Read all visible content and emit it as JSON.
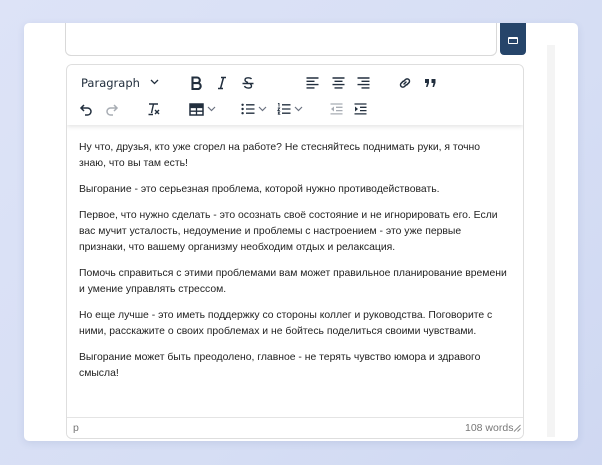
{
  "top_field": {
    "value": ""
  },
  "toolbar": {
    "block_format": "Paragraph",
    "buttons": [
      "bold-icon",
      "italic-icon",
      "strikethrough-icon",
      "align-left-icon",
      "align-center-icon",
      "align-right-icon",
      "link-icon",
      "quote-icon",
      "undo-icon",
      "redo-icon",
      "clear-formatting-icon",
      "table-icon",
      "bullet-list-icon",
      "numbered-list-icon",
      "outdent-icon",
      "indent-icon"
    ]
  },
  "content": {
    "paragraphs": [
      "Ну что, друзья, кто уже сгорел на работе? Не стесняйтесь поднимать руки, я точно знаю, что вы там есть!",
      "Выгорание - это серьезная проблема, которой нужно противодействовать.",
      "Первое, что нужно сделать - это осознать своё состояние и не игнорировать его. Если вас мучит усталость, недоумение и проблемы с настроением - это уже первые признаки, что вашему организму необходим отдых и релаксация.",
      "Помочь справиться с этими проблемами вам может правильное планирование времени и умение управлять стрессом.",
      "Но еще лучше - это иметь поддержку со стороны коллег и руководства. Поговорите с ними, расскажите о своих проблемах и не бойтесь поделиться своими чувствами.",
      "Выгорание может быть преодолено, главное - не терять чувство юмора и здравого смысла!"
    ]
  },
  "statusbar": {
    "path": "p",
    "word_count": "108 words"
  },
  "colors": {
    "toolbar_icon": "#222f3e",
    "top_button": "#26456a"
  }
}
